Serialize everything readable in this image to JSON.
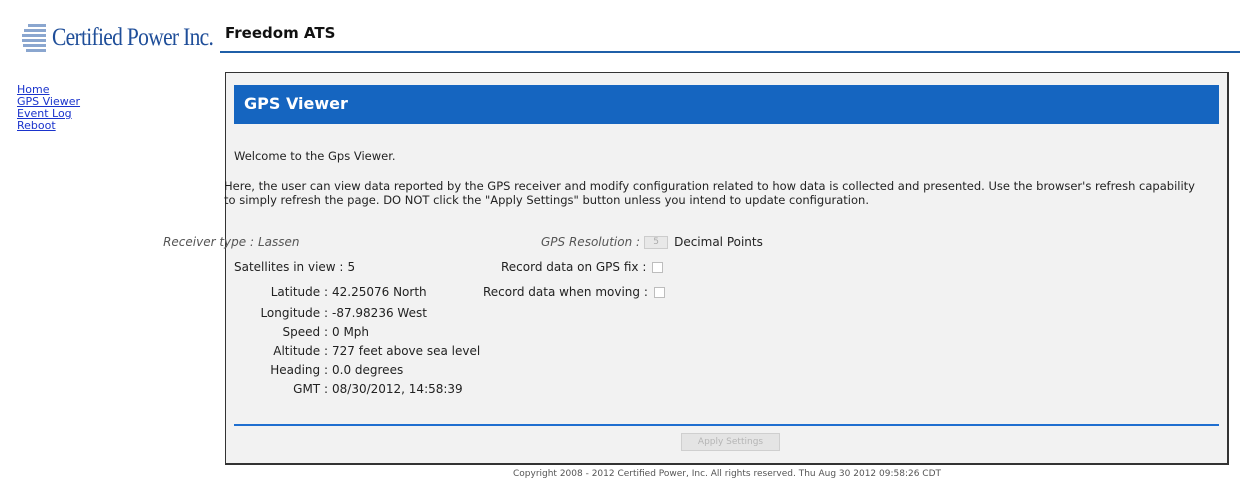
{
  "brand": {
    "logo_text": "Certified Power Inc.",
    "logo_color": "#1f4e99"
  },
  "header": {
    "title": "Freedom ATS"
  },
  "nav": {
    "items": [
      "Home",
      "GPS Viewer",
      "Event Log",
      "Reboot"
    ]
  },
  "panel": {
    "title": "GPS Viewer",
    "welcome": "Welcome to the Gps Viewer.",
    "description": "Here, the user can view data reported by the GPS receiver and modify configuration related to how data is collected and presented. Use the browser's refresh capability to simply refresh the page. DO NOT click the \"Apply Settings\" button unless you intend to update configuration."
  },
  "gps": {
    "receiver_type": {
      "label": "Receiver type :",
      "value": "Lassen"
    },
    "satellites": {
      "label": "Satellites in view :",
      "value": "5"
    },
    "latitude": {
      "label": "Latitude :",
      "value": "42.25076 North"
    },
    "longitude": {
      "label": "Longitude :",
      "value": "-87.98236 West"
    },
    "speed": {
      "label": "Speed :",
      "value": "0 Mph"
    },
    "altitude": {
      "label": "Altitude :",
      "value": "727 feet above sea level"
    },
    "heading": {
      "label": "Heading :",
      "value": "0.0 degrees"
    },
    "gmt": {
      "label": "GMT :",
      "value": "08/30/2012, 14:58:39"
    }
  },
  "settings": {
    "resolution_label": "GPS Resolution :",
    "resolution_value": "5",
    "resolution_suffix": "Decimal Points",
    "record_fix_label": "Record data on GPS fix :",
    "record_moving_label": "Record data when moving :",
    "apply_label": "Apply Settings"
  },
  "footer": {
    "copyright": "Copyright 2008 - 2012 Certified Power, Inc. All rights reserved. Thu Aug 30 2012 09:58:26 CDT"
  },
  "colors": {
    "panel_band": "#1565c0",
    "rule": "#1f5fa8",
    "nav_link": "#1a33cc"
  }
}
